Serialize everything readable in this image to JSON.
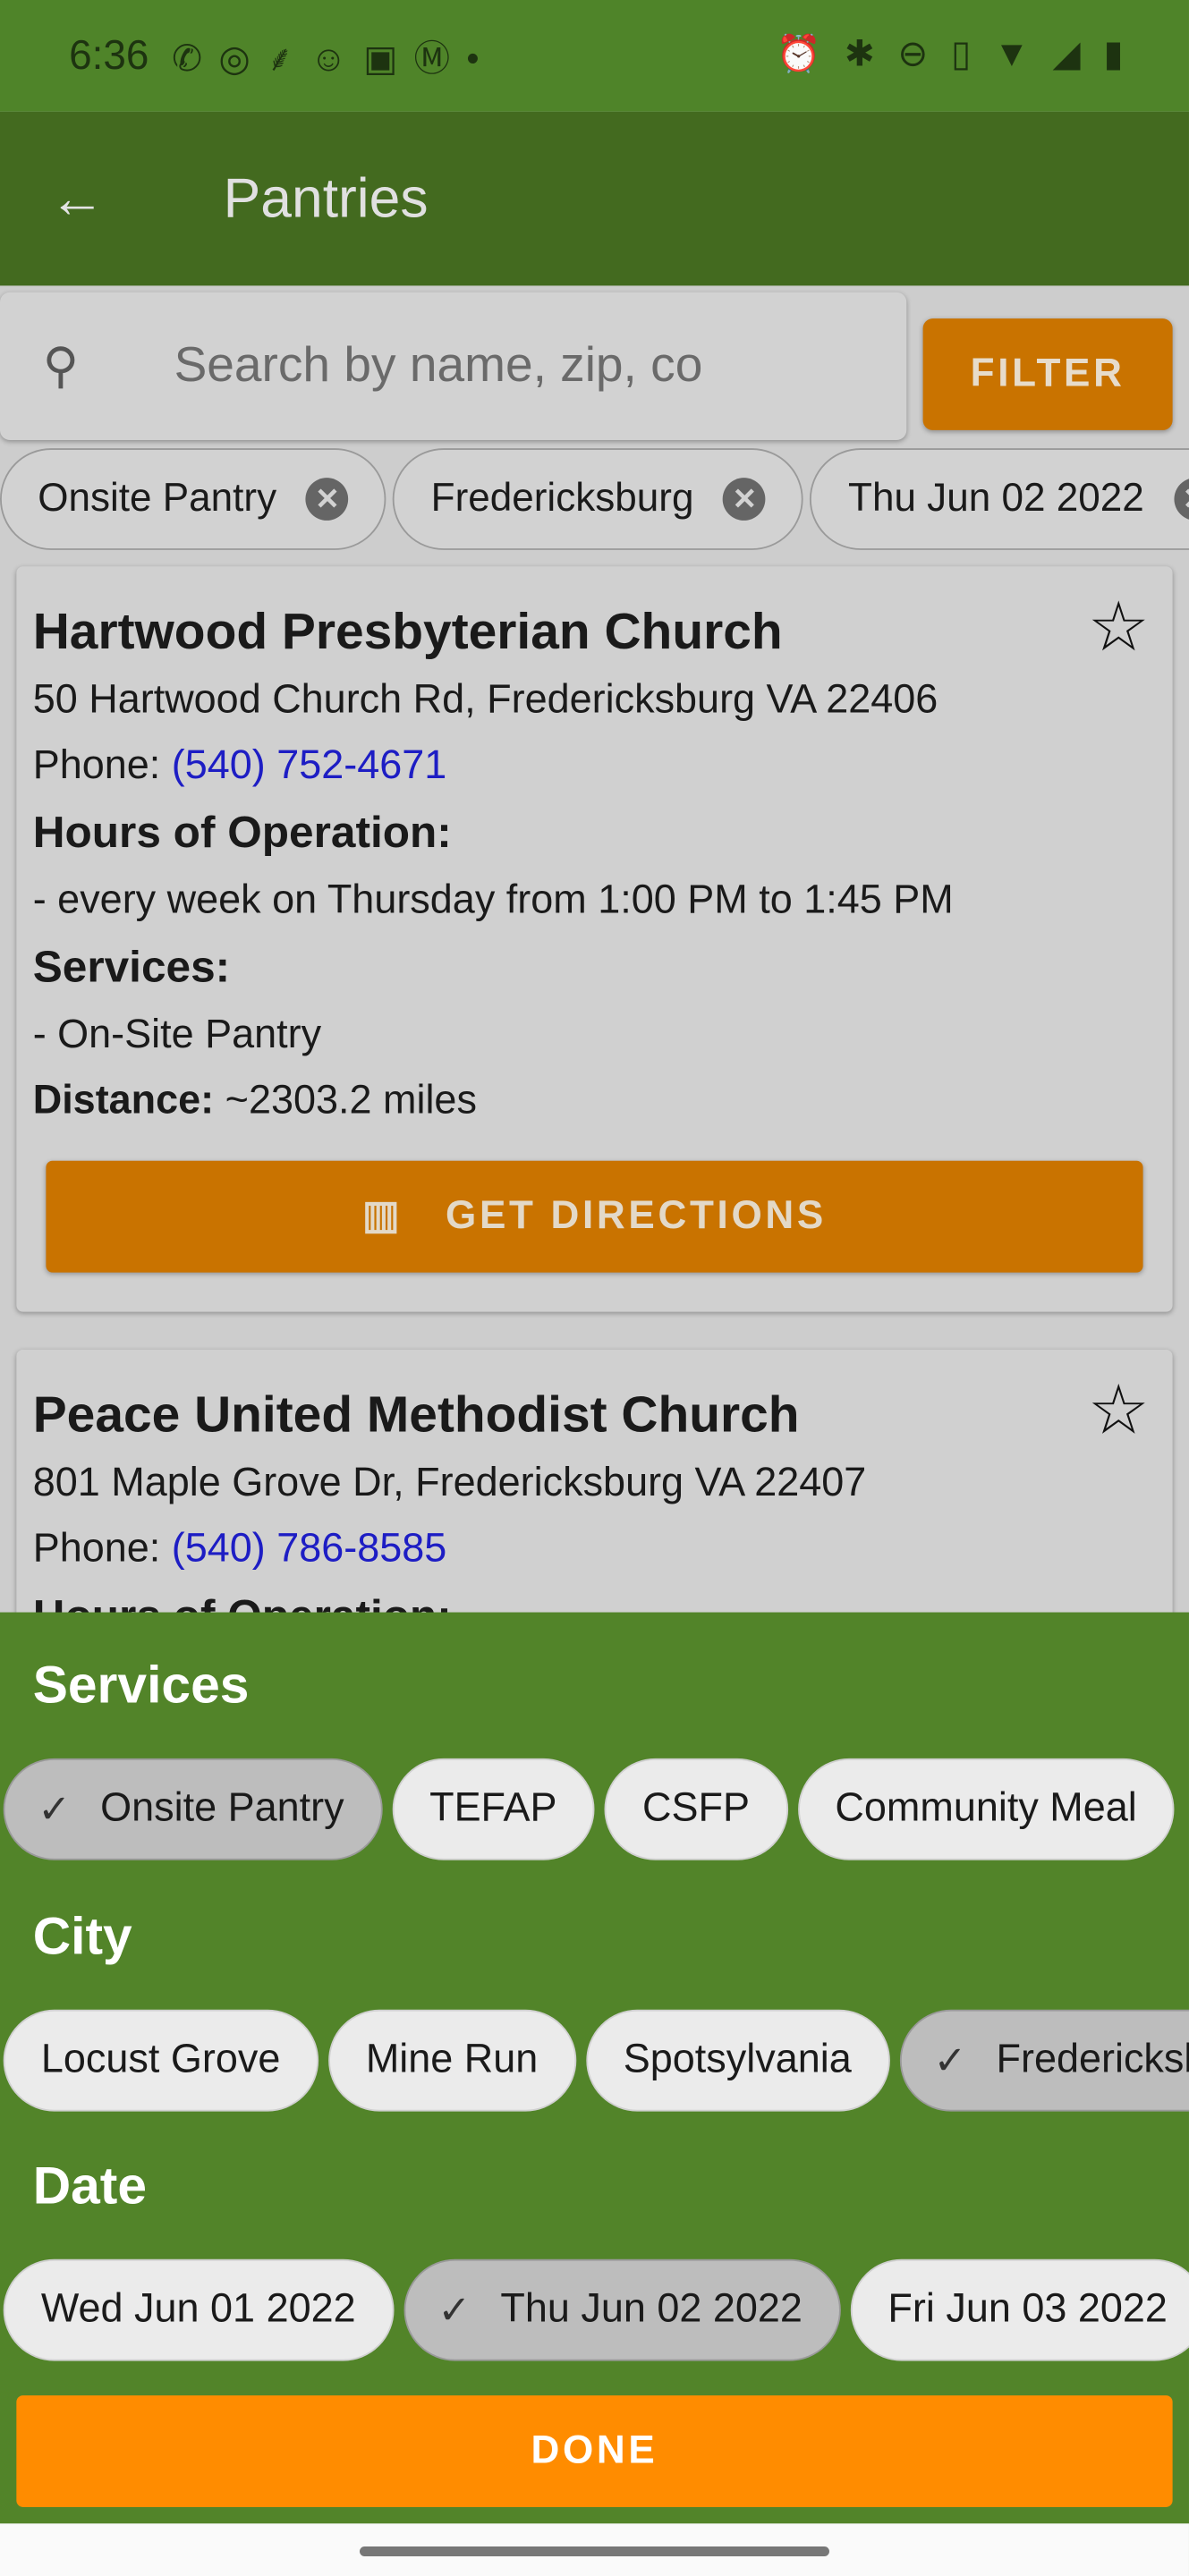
{
  "status_bar": {
    "time": "6:36",
    "left_icons": [
      "whatsapp-icon",
      "instagram-icon",
      "rabbit-icon",
      "mouse-icon",
      "photo-icon",
      "gmail-icon",
      "dot-icon"
    ],
    "right_icons": [
      "alarm-icon",
      "bluetooth-battery-icon",
      "do-not-disturb-icon",
      "vibrate-icon",
      "wifi-icon",
      "signal-icon",
      "battery-charging-icon"
    ]
  },
  "app_bar": {
    "title": "Pantries",
    "back_icon": "arrow-back-icon"
  },
  "search": {
    "placeholder": "Search by name, zip, co",
    "value": ""
  },
  "filter_label": "FILTER",
  "active_filters": [
    "Onsite Pantry",
    "Fredericksburg",
    "Thu Jun 02 2022"
  ],
  "pantries": [
    {
      "name": "Hartwood Presbyterian Church",
      "address": "50 Hartwood Church Rd, Fredericksburg VA 22406",
      "phone_label": "Phone:",
      "phone": "(540) 752-4671",
      "hours_label": "Hours of Operation:",
      "hours": "- every week on Thursday from 1:00 PM to 1:45 PM",
      "services_label": "Services:",
      "services": "- On-Site Pantry",
      "distance_label": "Distance:",
      "distance": "~2303.2 miles",
      "directions_label": "GET DIRECTIONS",
      "favorited": false
    },
    {
      "name": "Peace United Methodist Church",
      "address": "801 Maple Grove Dr, Fredericksburg VA 22407",
      "phone_label": "Phone:",
      "phone": "(540) 786-8585",
      "hours_label": "Hours of Operation:",
      "favorited": false
    }
  ],
  "filter_sheet": {
    "services_title": "Services",
    "services": [
      {
        "label": "Onsite Pantry",
        "selected": true
      },
      {
        "label": "TEFAP",
        "selected": false
      },
      {
        "label": "CSFP",
        "selected": false
      },
      {
        "label": "Community Meal",
        "selected": false
      }
    ],
    "city_title": "City",
    "cities": [
      {
        "label": "Locust Grove",
        "selected": false
      },
      {
        "label": "Mine Run",
        "selected": false
      },
      {
        "label": "Spotsylvania",
        "selected": false
      },
      {
        "label": "Fredericksburg",
        "selected": true
      }
    ],
    "date_title": "Date",
    "dates": [
      {
        "label": "Wed Jun 01 2022",
        "selected": false
      },
      {
        "label": "Thu Jun 02 2022",
        "selected": true
      },
      {
        "label": "Fri Jun 03 2022",
        "selected": false
      }
    ],
    "done_label": "DONE"
  },
  "colors": {
    "primary": "#528429",
    "primary_dark": "#436a1f",
    "accent": "#ff8c00",
    "link": "#1d1dc4"
  }
}
